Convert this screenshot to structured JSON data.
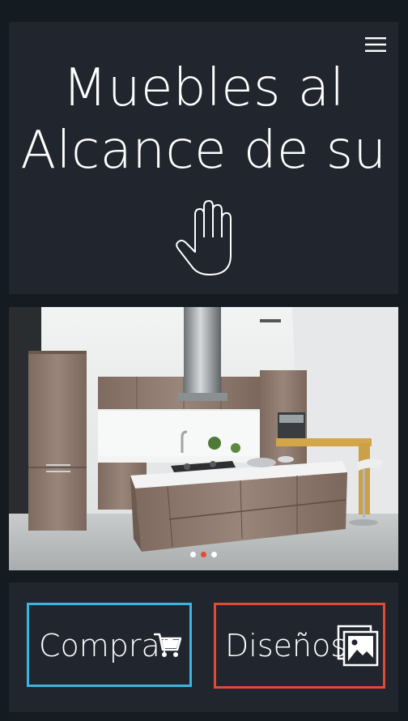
{
  "hero": {
    "title_line1": "Muebles al",
    "title_line2": "Alcance de su",
    "icon": "hand-icon"
  },
  "header": {
    "menu_icon": "hamburger-menu-icon"
  },
  "carousel": {
    "slide_count": 3,
    "active_slide": 2
  },
  "actions": {
    "buy_label": "Comprar",
    "buy_icon": "shopping-cart-icon",
    "designs_label": "Diseños",
    "designs_icon": "gallery-icon"
  },
  "colors": {
    "background": "#141b21",
    "panel": "#20252e",
    "buy_border": "#3cb3e0",
    "designs_border": "#e04b34",
    "active_dot": "#e04b34"
  }
}
